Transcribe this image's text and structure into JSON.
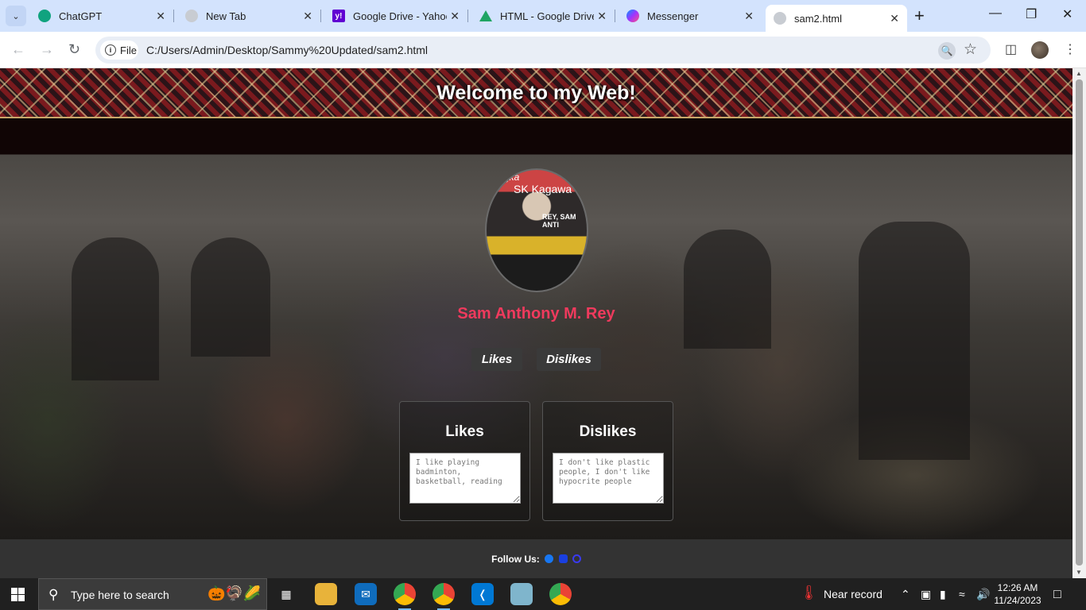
{
  "browser": {
    "tabs": [
      {
        "title": "ChatGPT",
        "icon": "chatgpt-icon",
        "color": "#10a37f"
      },
      {
        "title": "New Tab",
        "icon": "newtab-icon",
        "color": "#9aa0a6"
      },
      {
        "title": "Google Drive - Yahoo",
        "icon": "yahoo-icon",
        "color": "#6001d2"
      },
      {
        "title": "HTML - Google Drive",
        "icon": "drive-icon",
        "color": "#1fa463"
      },
      {
        "title": "Messenger",
        "icon": "messenger-icon",
        "color": "#a033ff"
      },
      {
        "title": "sam2.html",
        "icon": "file-icon",
        "color": "#9aa0a6"
      }
    ],
    "active_tab": 5,
    "address_chip": "File",
    "url": "C:/Users/Admin/Desktop/Sammy%20Updated/sam2.html"
  },
  "page": {
    "banner_title": "Welcome to my Web!",
    "avatar": {
      "line1": "gka",
      "line2": "SK Kagawa",
      "line3": "REY, SAM ANTI"
    },
    "name": "Sam Anthony M. Rey",
    "buttons": {
      "likes": "Likes",
      "dislikes": "Dislikes"
    },
    "cards": {
      "likes": {
        "heading": "Likes",
        "text": "I like playing badminton, basketball, reading"
      },
      "dislikes": {
        "heading": "Dislikes",
        "text": "I don't like plastic people, I don't like hypocrite people"
      }
    },
    "footer": {
      "follow_label": "Follow Us:"
    },
    "name_color": "#ef3a5d"
  },
  "taskbar": {
    "search_placeholder": "Type here to search",
    "weather": "Near record",
    "time": "12:26 AM",
    "date": "11/24/2023"
  }
}
